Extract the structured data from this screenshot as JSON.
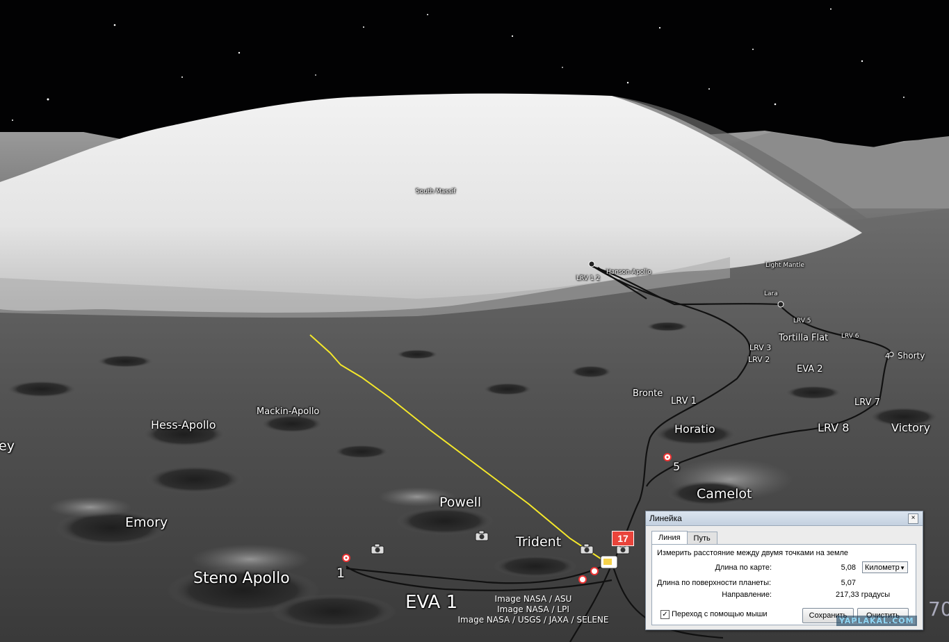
{
  "map": {
    "labels": {
      "south_massif": "South Massif",
      "light_mantle": "Light Mantle",
      "lrv1_2": "LRV 1 2",
      "hanson_apollo": "Hanson-Apollo",
      "lara": "Lara",
      "lrv5": "LRV 5",
      "tortilla_flat": "Tortilla Flat",
      "lrv6": "LRV 6",
      "lrv3": "LRV 3",
      "lrv2": "LRV 2",
      "shorty": "Shorty",
      "stop4": "4",
      "eva2": "EVA 2",
      "bronte": "Bronte",
      "lrv1": "LRV 1",
      "lrv7": "LRV 7",
      "horatio": "Horatio",
      "lrv8": "LRV 8",
      "victory": "Victory",
      "hess_apollo": "Hess-Apollo",
      "mackin_apollo": "Mackin-Apollo",
      "ey": "ey",
      "stop5": "5",
      "camelot": "Camelot",
      "powell": "Powell",
      "emory": "Emory",
      "trident": "Trident",
      "steno_apollo": "Steno Apollo",
      "stop1": "1",
      "eva1": "EVA 1"
    },
    "badge": "17",
    "credits": [
      "Image NASA / ASU",
      "Image NASA / LPI",
      "Image NASA / USGS / JAXA / SELENE"
    ]
  },
  "ruler": {
    "title": "Линейка",
    "close": "×",
    "tabs": [
      "Линия",
      "Путь"
    ],
    "description": "Измерить расстояние между двумя точками на земле",
    "map_length_label": "Длина по карте:",
    "map_length_value": "5,08",
    "unit": "Километр",
    "surface_length_label": "Длина по поверхности планеты:",
    "surface_length_value": "5,07",
    "heading_label": "Направление:",
    "heading_value": "217,33 градусы",
    "mouse_nav_label": "Переход с помощью мыши",
    "mouse_nav_checked": "✓",
    "save_button": "Сохранить",
    "clear_button": "Очистить"
  },
  "overlay": {
    "watermark": "YAPLAKAL.COM",
    "nav_digit": "70"
  },
  "colors": {
    "measure_line": "#f5e82a",
    "traverse": "#111111",
    "badge": "#e9443b"
  }
}
